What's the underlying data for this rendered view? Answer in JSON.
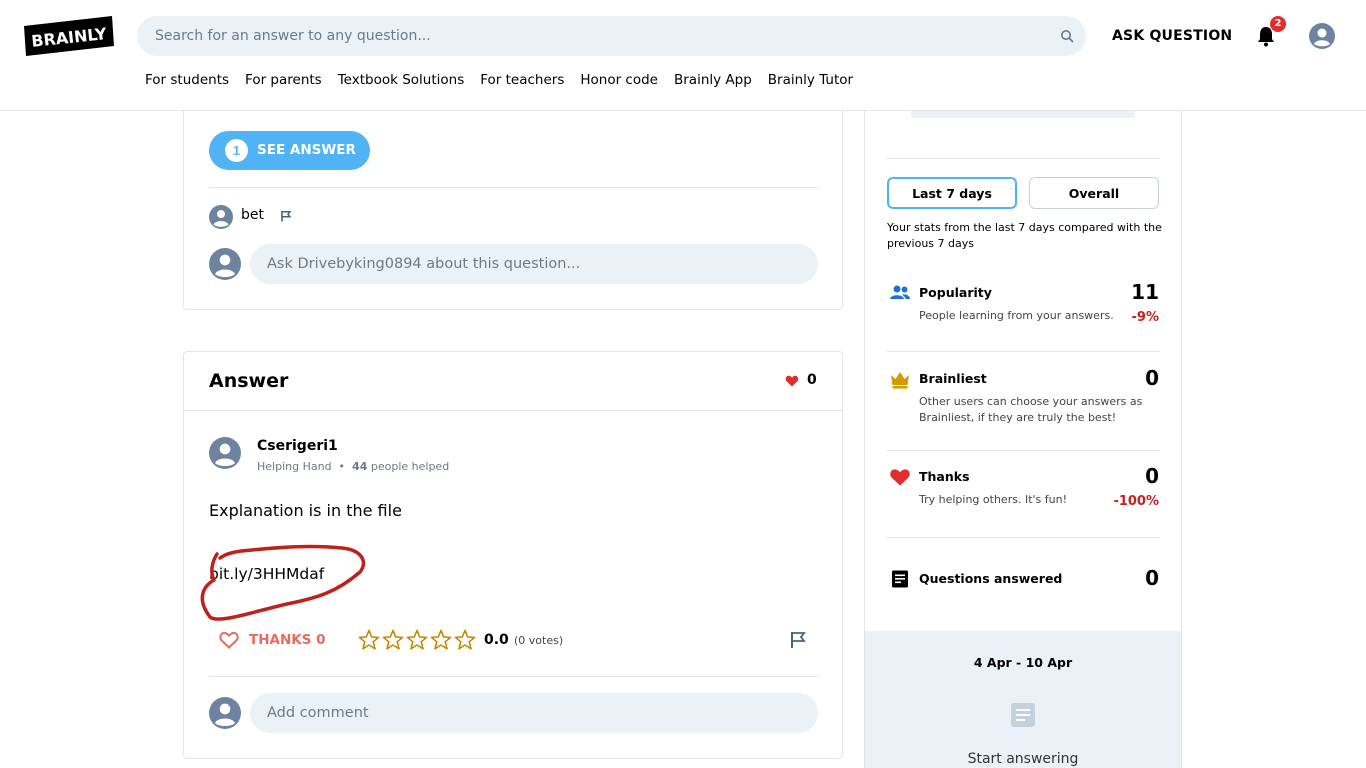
{
  "header": {
    "logo_text": "BRAINLY",
    "search_placeholder": "Search for an answer to any question...",
    "ask_button": "ASK QUESTION",
    "notifications_count": "2",
    "nav": [
      "For students",
      "For parents",
      "Textbook Solutions",
      "For teachers",
      "Honor code",
      "Brainly App",
      "Brainly Tutor"
    ]
  },
  "question_card": {
    "see_answer_count": "1",
    "see_answer_label": "SEE ANSWER",
    "asker_name": "bet",
    "comment_placeholder": "Ask Drivebyking0894 about this question..."
  },
  "answer_card": {
    "title": "Answer",
    "thanks_count": "0",
    "author_name": "Cserigeri1",
    "author_rank": "Helping Hand",
    "author_helped_count": "44",
    "author_helped_suffix": "people helped",
    "body_text": "Explanation is in the file",
    "link_text": "bit.ly/3HHMdaf",
    "thanks_label": "THANKS 0",
    "rating_value": 0.0,
    "rating_text": "0.0",
    "stars_total": 5,
    "votes_text": "(0 votes)",
    "comment_placeholder": "Add comment"
  },
  "stats_panel": {
    "tabs": [
      {
        "label": "Last 7 days",
        "active": true
      },
      {
        "label": "Overall",
        "active": false
      }
    ],
    "note": "Your stats from the last 7 days compared with the previous 7 days",
    "stats": [
      {
        "icon": "people-icon",
        "title": "Popularity",
        "desc": "People learning from your answers.",
        "value": "11",
        "change": "-9%"
      },
      {
        "icon": "crown-icon",
        "title": "Brainliest",
        "desc": "Other users can choose your answers as Brainliest, if they are truly the best!",
        "value": "0",
        "change": ""
      },
      {
        "icon": "heart-icon",
        "title": "Thanks",
        "desc": "Try helping others. It's fun!",
        "value": "0",
        "change": "-100%"
      },
      {
        "icon": "document-icon",
        "title": "Questions answered",
        "desc": "",
        "value": "0",
        "change": ""
      }
    ],
    "date_range": "4 Apr - 10 Apr",
    "start_answering": "Start answering"
  },
  "colors": {
    "accent_blue": "#4fb3f6",
    "thanks_red": "#e86c5e",
    "heart_red": "#e02d2d",
    "star_gold": "#c98600",
    "crown_gold": "#d29b00",
    "people_blue": "#1f73cc",
    "negative_red": "#c5221f",
    "scribble_red": "#c0201c"
  }
}
